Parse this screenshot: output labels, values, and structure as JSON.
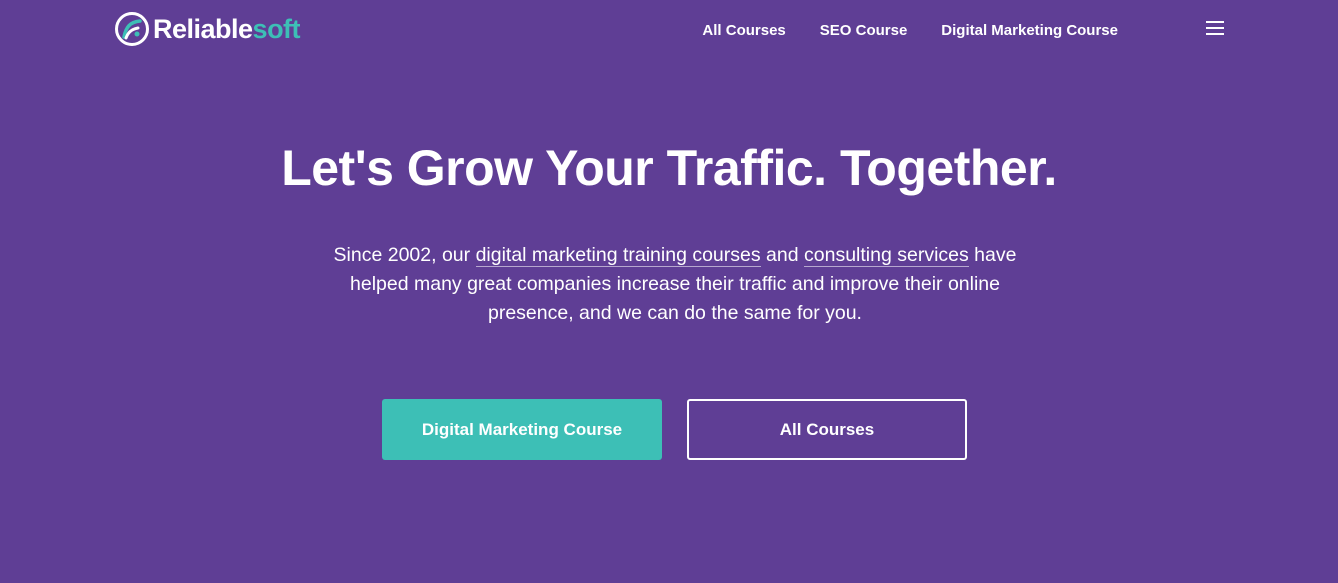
{
  "colors": {
    "background": "#5f3e95",
    "accent": "#3dbfb6",
    "text": "#ffffff"
  },
  "header": {
    "logo": {
      "text_primary": "Reliable",
      "text_secondary": "soft",
      "icon": "reliablesoft-logo-icon"
    },
    "nav": [
      {
        "label": "All Courses"
      },
      {
        "label": "SEO Course"
      },
      {
        "label": "Digital Marketing Course"
      }
    ],
    "menu_icon": "hamburger-menu-icon"
  },
  "hero": {
    "title": "Let's Grow Your Traffic. Together.",
    "text_part1": "Since 2002, our ",
    "link1": "digital marketing training courses",
    "text_part2": " and ",
    "link2": "consulting services",
    "text_part3": " have helped many great companies increase their traffic and improve their online presence, and we can do the same for you.",
    "buttons": {
      "primary": "Digital Marketing Course",
      "secondary": "All Courses"
    }
  }
}
